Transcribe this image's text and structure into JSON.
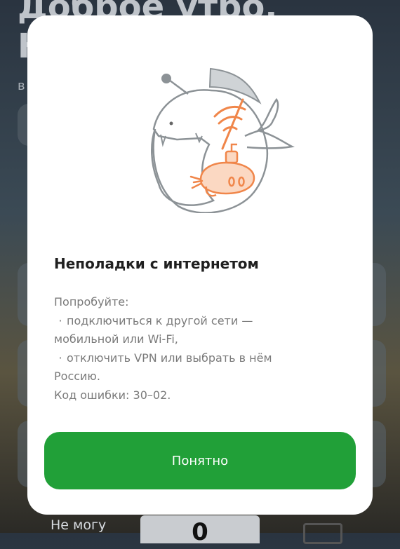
{
  "background": {
    "greeting_line1": "Доброе утро,",
    "greeting_line2": "Н",
    "small_label": "в",
    "bottom_left_label": "Не могу",
    "keypad_digit": "0"
  },
  "dialog": {
    "title": "Неполадки с интернетом",
    "intro": "Попробуйте:",
    "bullets": [
      {
        "line1": "подключиться к другой сети —",
        "line2": "мобильной или Wi-Fi,"
      },
      {
        "line1": "отключить VPN или выбрать в нём",
        "line2": "Россию."
      }
    ],
    "error_code": "Код ошибки: 30–02.",
    "button_label": "Понятно",
    "illustration_icon": "anglerfish-no-internet-icon"
  },
  "colors": {
    "accent_green": "#21a038",
    "illustration_orange": "#f0864a",
    "illustration_grey": "#8c9296"
  }
}
